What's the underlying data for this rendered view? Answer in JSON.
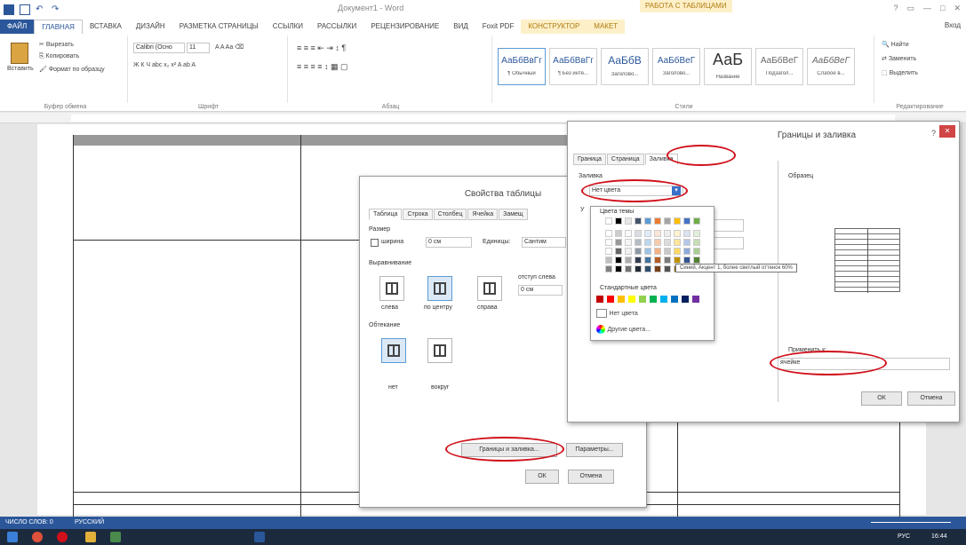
{
  "titlebar": {
    "document_title": "Документ1 - Word",
    "context_group": "РАБОТА С ТАБЛИЦАМИ",
    "controls": [
      "?",
      "▭",
      "—",
      "□",
      "✕"
    ]
  },
  "tabs": {
    "file": "ФАЙЛ",
    "items": [
      "ГЛАВНАЯ",
      "ВСТАВКА",
      "ДИЗАЙН",
      "РАЗМЕТКА СТРАНИЦЫ",
      "ССЫЛКИ",
      "РАССЫЛКИ",
      "РЕЦЕНЗИРОВАНИЕ",
      "ВИД",
      "Foxit PDF"
    ],
    "context_items": [
      "КОНСТРУКТОР",
      "МАКЕТ"
    ],
    "user": "Вход"
  },
  "ribbon": {
    "clipboard": {
      "paste": "Вставить",
      "cut": "Вырезать",
      "copy": "Копировать",
      "format_painter": "Формат по образцу",
      "label": "Буфер обмена"
    },
    "font": {
      "name": "Calibri (Осно",
      "size": "11",
      "row1": "A  A  Aa  ⌫",
      "row2": "Ж  К  Ч  abc  x₂  x²  A  ab  A",
      "label": "Шрифт"
    },
    "paragraph": {
      "row1": "≡  ≡  ≡  ⇤  ⇥  ↕  ¶",
      "row2": "≡  ≡  ≡  ≡  ↕  ▦  ▢",
      "label": "Абзац"
    },
    "styles": {
      "items": [
        {
          "sample": "АаБбВвГг",
          "name": "¶ Обычный"
        },
        {
          "sample": "АаБбВвГг",
          "name": "¶ Без инте..."
        },
        {
          "sample": "АаБбВ",
          "name": "Заголово..."
        },
        {
          "sample": "АаБбВеГ",
          "name": "Заголово..."
        },
        {
          "sample": "АаБ",
          "name": "Название"
        },
        {
          "sample": "АаБбВеГ",
          "name": "Подзагол..."
        },
        {
          "sample": "АаБбВеГ",
          "name": "Слабое в..."
        }
      ],
      "label": "Стили"
    },
    "editing": {
      "find": "Найти",
      "replace": "Заменить",
      "select": "Выделить",
      "label": "Редактирование"
    }
  },
  "table_props": {
    "title": "Свойства таблицы",
    "tabs": [
      "Таблица",
      "Строка",
      "Столбец",
      "Ячейка",
      "Замещ"
    ],
    "size_label": "Размер",
    "width_checkbox": "ширина",
    "width_value": "0 см",
    "measure_label": "Единицы:",
    "measure_value": "Сантим",
    "alignment_label": "Выравнивание",
    "align_options": [
      "слева",
      "по центру",
      "справа"
    ],
    "indent_label": "отступ слева",
    "indent_value": "0 см",
    "wrap_label": "Обтекание",
    "wrap_options": [
      "нет",
      "вокруг"
    ],
    "borders_button": "Границы и заливка...",
    "params_button": "Параметры...",
    "ok": "ОК",
    "cancel": "Отмена"
  },
  "borders": {
    "title": "Границы и заливка",
    "help": "?",
    "close": "✕",
    "tabs": [
      "Граница",
      "Страница",
      "Заливка"
    ],
    "fill_label": "Заливка",
    "fill_value": "Нет цвета",
    "pattern_label": "У",
    "preview_label": "Образец",
    "apply_label": "Применить к:",
    "apply_value": "ячейке",
    "ok": "ОК",
    "cancel": "Отмена"
  },
  "palette": {
    "theme_label": "Цвета темы",
    "standard_label": "Стандартные цвета",
    "no_color": "Нет цвета",
    "more_colors": "Другие цвета...",
    "tooltip": "Синий, Акцент 1, более светлый оттенок 60%",
    "theme_colors": [
      "#ffffff",
      "#000000",
      "#e7e6e6",
      "#44546a",
      "#5b9bd5",
      "#ed7d31",
      "#a5a5a5",
      "#ffc000",
      "#4472c4",
      "#70ad47"
    ],
    "standard_colors": [
      "#c00000",
      "#ff0000",
      "#ffc000",
      "#ffff00",
      "#92d050",
      "#00b050",
      "#00b0f0",
      "#0070c0",
      "#002060",
      "#7030a0"
    ]
  },
  "status": {
    "page": "ЧИСЛО СЛОВ: 0",
    "lang": "РУССКИЙ",
    "zoom": "100%"
  },
  "taskbar": {
    "clock": "16:44",
    "lang": "РУС"
  },
  "colors": {
    "accent": "#2b579a",
    "highlight": "#d0101a",
    "context": "#b07a10"
  }
}
